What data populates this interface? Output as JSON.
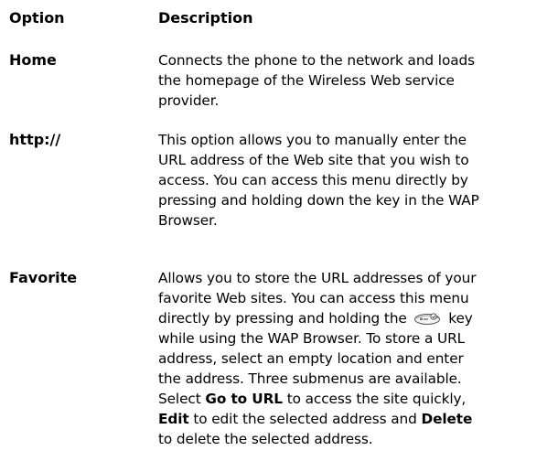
{
  "header": {
    "option": "Option",
    "description": "Description"
  },
  "rows": [
    {
      "option": "Home",
      "lines": [
        "Connects the phone to the network and loads",
        "the homepage of the Wireless Web service",
        "provider."
      ]
    },
    {
      "option": "http://",
      "lines": [
        "This option allows you to manually enter the",
        "URL address of the Web site that you wish to",
        "access. You can access this menu directly by",
        "pressing and holding down the key in the WAP",
        "Browser."
      ]
    },
    {
      "option": "Favorite",
      "line1": "Allows you to store the URL addresses of your",
      "line2": "favorite Web sites. You can access this menu",
      "line3_before": "directly by pressing and holding the",
      "line3_icon": "wap-key-icon",
      "line3_after": "key",
      "line4": "while using the WAP Browser. To store a URL",
      "line5": "address, select an empty location and enter",
      "line6": "the address. Three submenus are available.",
      "line7_pre": "Select",
      "line7_bold": "Go to URL",
      "line7_post": "to access the site quickly,",
      "line8_bold1": "Edit",
      "line8_mid": "to edit the selected address and",
      "line8_bold2": "Delete",
      "line9": "to delete the selected address."
    }
  ]
}
